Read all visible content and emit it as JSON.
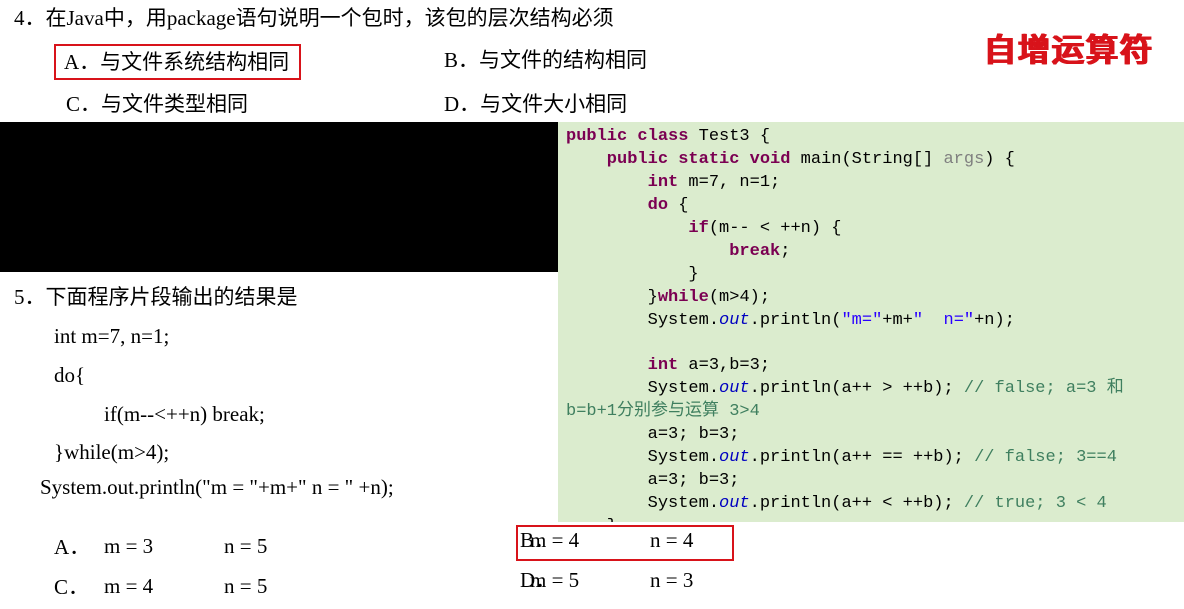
{
  "title_annotation": "自增运算符",
  "q4": {
    "number": "4．",
    "stem": "在Java中，用package语句说明一个包时，该包的层次结构必须",
    "A": {
      "label": "A．",
      "text": "与文件系统结构相同"
    },
    "B": {
      "label": "B．",
      "text": "与文件的结构相同"
    },
    "C": {
      "label": "C．",
      "text": "与文件类型相同"
    },
    "D": {
      "label": "D．",
      "text": "与文件大小相同"
    },
    "correct": "A"
  },
  "q5": {
    "number": "5．",
    "stem": "下面程序片段输出的结果是",
    "code": {
      "l1": "int m=7, n=1;",
      "l2": "do{",
      "l3": "if(m--<++n) break;",
      "l4": "}while(m>4);",
      "l5": "System.out.println(\"m = \"+m+\"       n = \" +n);"
    },
    "A": {
      "label": "A．",
      "col1": "m = 3",
      "col2": "n = 5"
    },
    "B": {
      "label": "B．",
      "col1": "m = 4",
      "col2": "n = 4"
    },
    "C": {
      "label": "C．",
      "col1": "m = 4",
      "col2": "n = 5"
    },
    "D": {
      "label": "D．",
      "col1": "m = 5",
      "col2": "n = 3"
    },
    "correct": "B"
  },
  "code_panel": {
    "t01a": "public class",
    "t01b": " Test3 {",
    "t02a": "    public static void",
    "t02b": " main(String[] ",
    "t02c": "args",
    "t02d": ") {",
    "t03a": "        int",
    "t03b": " m=7, n=1;",
    "t04a": "        do",
    "t04b": " {",
    "t05a": "            if",
    "t05b": "(m-- < ++n) {",
    "t06a": "                break",
    "t06b": ";",
    "t07": "            }",
    "t08a": "        }",
    "t08b": "while",
    "t08c": "(m>4);",
    "t09a": "        System.",
    "t09b": "out",
    "t09c": ".println(",
    "t09d": "\"m=\"",
    "t09e": "+m+",
    "t09f": "\"  n=\"",
    "t09g": "+n);",
    "blank": "",
    "t10a": "        int",
    "t10b": " a=3,b=3;",
    "t11a": "        System.",
    "t11b": "out",
    "t11c": ".println(a++ > ++b); ",
    "t11d": "// false; a=3 和",
    "t11e": "b=b+1分别参与运算 3>4",
    "t12": "        a=3; b=3;",
    "t13a": "        System.",
    "t13b": "out",
    "t13c": ".println(a++ == ++b); ",
    "t13d": "// false; 3==4",
    "t14": "        a=3; b=3;",
    "t15a": "        System.",
    "t15b": "out",
    "t15c": ".println(a++ < ++b); ",
    "t15d": "// true; 3 < 4",
    "t16": "    }",
    "t17": "}"
  }
}
